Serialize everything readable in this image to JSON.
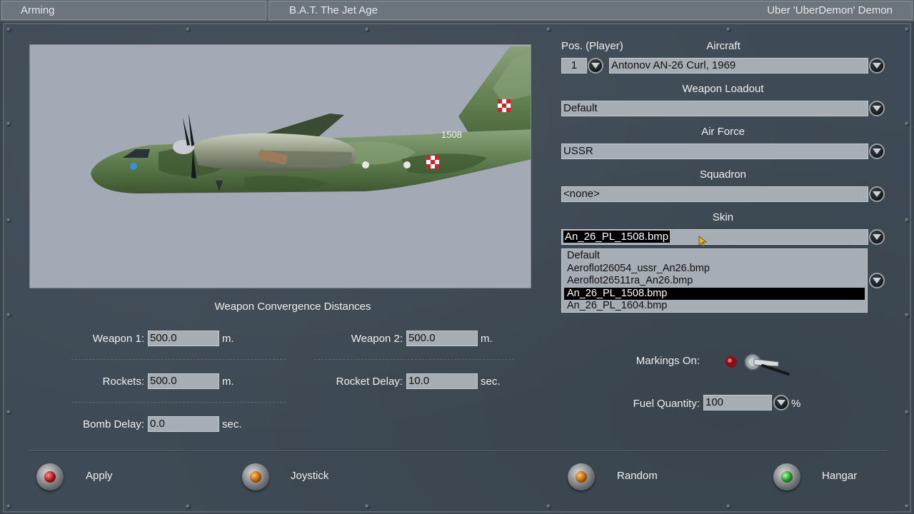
{
  "topbar": {
    "screen_title": "Arming",
    "game_title": "B.A.T. The Jet Age",
    "player_name": "Uber 'UberDemon' Demon"
  },
  "convergence": {
    "heading": "Weapon Convergence Distances",
    "weapon1": {
      "label": "Weapon 1:",
      "value": "500.0",
      "unit": "m."
    },
    "weapon2": {
      "label": "Weapon 2:",
      "value": "500.0",
      "unit": "m."
    },
    "rockets": {
      "label": "Rockets:",
      "value": "500.0",
      "unit": "m."
    },
    "rocket_delay": {
      "label": "Rocket Delay:",
      "value": "10.0",
      "unit": "sec."
    },
    "bomb_delay": {
      "label": "Bomb Delay:",
      "value": "0.0",
      "unit": "sec."
    }
  },
  "aircraft_preview": {
    "tail_number": "1508",
    "colors": {
      "background": "#a3aab5",
      "camo_green": "#5f7d4e",
      "camo_dark": "#3d5530",
      "camo_light": "#8aa179",
      "roundel_red": "#d4202a"
    }
  },
  "setup": {
    "pos_label": "Pos. (Player)",
    "pos_value": "1",
    "aircraft_label": "Aircraft",
    "aircraft_value": "Antonov AN-26 Curl,  1969",
    "loadout_label": "Weapon Loadout",
    "loadout_value": "Default",
    "airforce_label": "Air Force",
    "airforce_value": "USSR",
    "squadron_label": "Squadron",
    "squadron_value": "<none>",
    "skin_label": "Skin",
    "skin_value": "An_26_PL_1508.bmp",
    "skin_options": [
      {
        "label": "Default",
        "selected": false
      },
      {
        "label": "Aeroflot26054_ussr_An26.bmp",
        "selected": false
      },
      {
        "label": "Aeroflot26511ra_An26.bmp",
        "selected": false
      },
      {
        "label": "An_26_PL_1508.bmp",
        "selected": true
      },
      {
        "label": "An_26_PL_1604.bmp",
        "selected": false
      }
    ],
    "markings_label": "Markings On:",
    "markings_on": true,
    "fuel_label": "Fuel Quantity:",
    "fuel_value": "100",
    "fuel_unit": "%"
  },
  "actions": {
    "apply": "Apply",
    "joystick": "Joystick",
    "random": "Random",
    "hangar": "Hangar"
  },
  "theme": {
    "panel": "#3e4a55",
    "field": "#a6adb5",
    "selection": "#000000",
    "lamp_apply": "red",
    "lamp_joystick": "amber",
    "lamp_random": "amber",
    "lamp_hangar": "green"
  },
  "icons": [
    "chevron-down-icon",
    "cursor-icon",
    "toggle-switch-icon",
    "indicator-lamp-icon"
  ]
}
